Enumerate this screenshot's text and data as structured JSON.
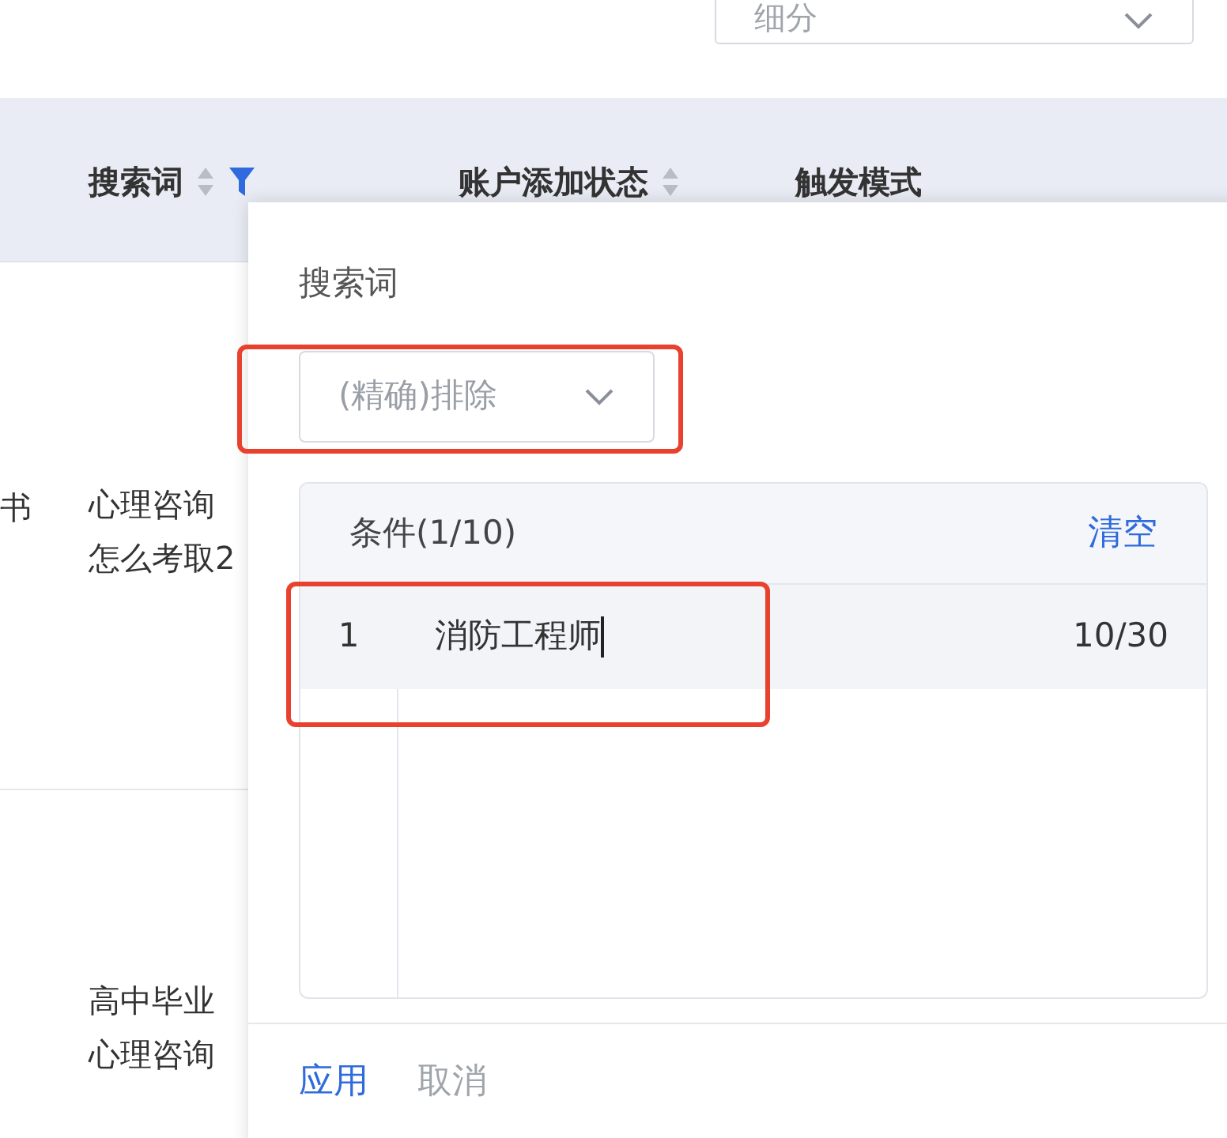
{
  "segment_select": {
    "value": "细分"
  },
  "table": {
    "columns": [
      {
        "label": "搜索词",
        "sortable": true,
        "filtered": true
      },
      {
        "label": "账户添加状态",
        "sortable": true,
        "filtered": false
      },
      {
        "label": "触发模式",
        "sortable": false,
        "filtered": false
      }
    ],
    "rows": [
      {
        "left_cell": "书",
        "search_term": [
          "心理咨询",
          "怎么考取2"
        ]
      },
      {
        "search_term": [
          "高中毕业",
          "心理咨询"
        ]
      }
    ]
  },
  "filter_popup": {
    "title": "搜索词",
    "match_select": {
      "value": "(精确)排除"
    },
    "conditions": {
      "header": "条件(1/10)",
      "clear_link": "清空",
      "rows": [
        {
          "index": "1",
          "value": "消防工程师",
          "count": "10/30",
          "selected": true
        }
      ]
    },
    "buttons": [
      {
        "label": "应用",
        "kind": "primary"
      },
      {
        "label": "取消",
        "kind": "secondary"
      }
    ]
  }
}
